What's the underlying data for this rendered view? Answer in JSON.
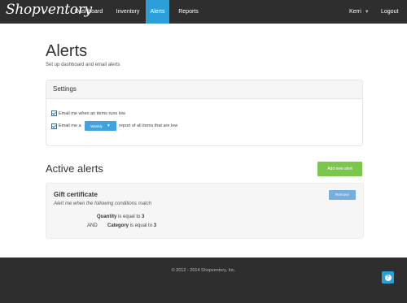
{
  "nav": {
    "brand": "Shopventory",
    "items": [
      {
        "label": "Dashboard",
        "active": false
      },
      {
        "label": "Inventory",
        "active": false
      },
      {
        "label": "Alerts",
        "active": true
      },
      {
        "label": "Reports",
        "active": false
      }
    ],
    "user": "Kerri",
    "logout": "Logout"
  },
  "page": {
    "title": "Alerts",
    "subtitle": "Set up dashboard and email alerts"
  },
  "settings": {
    "title": "Settings",
    "option1": "Email me when an items runs low",
    "option2_prefix": "Email me a",
    "frequency": "Weekly",
    "option2_suffix": "report of all items that are low"
  },
  "active_alerts": {
    "title": "Active alerts",
    "add_label": "Add new alert",
    "alert": {
      "name": "Gift certificate",
      "description": "Alert me when the following conditions match",
      "remove_label": "Remove",
      "conditions": [
        {
          "joiner": "",
          "field": "Quantity",
          "op": "is equal to",
          "value": "3"
        },
        {
          "joiner": "AND",
          "field": "Category",
          "op": "is equal to",
          "value": "3"
        }
      ]
    }
  },
  "footer": {
    "copyright": "© 2012 - 2014 Shopventory, Inc.",
    "help_icon": "question-icon"
  },
  "colors": {
    "nav_bg": "#2e2e2e",
    "accent": "#2ba0d8",
    "add_green": "#7bc74b",
    "remove_blue": "#76aee0"
  }
}
